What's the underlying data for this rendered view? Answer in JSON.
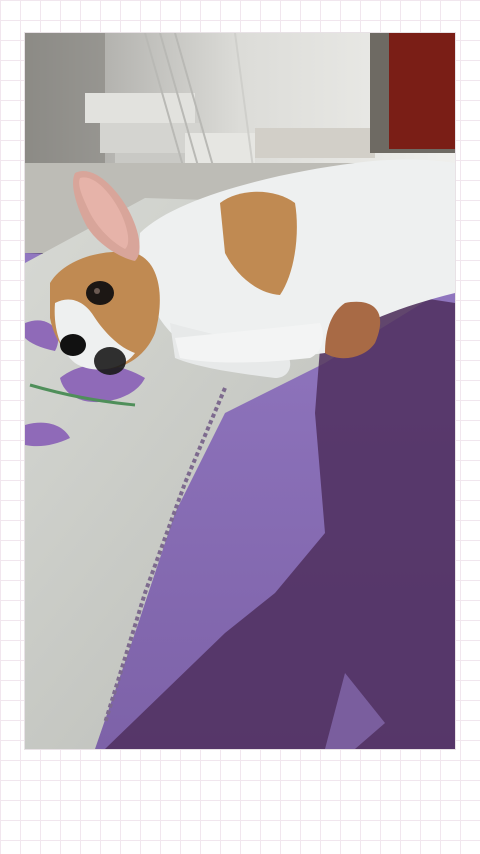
{
  "photo": {
    "subject": "dog-lying-on-bed",
    "colors": {
      "page_background": "#ffffff",
      "grid_line": "#f1e6ee",
      "blanket_purple": "#8a6fb5",
      "shadow_purple": "#4f2f5e",
      "sheet_white": "#d8dad5",
      "flower_purple": "#8f6ab8",
      "dog_white": "#eef0f0",
      "dog_tan": "#c08a52",
      "door_red": "#7a1e16",
      "wall": "#e9e9e6"
    }
  }
}
